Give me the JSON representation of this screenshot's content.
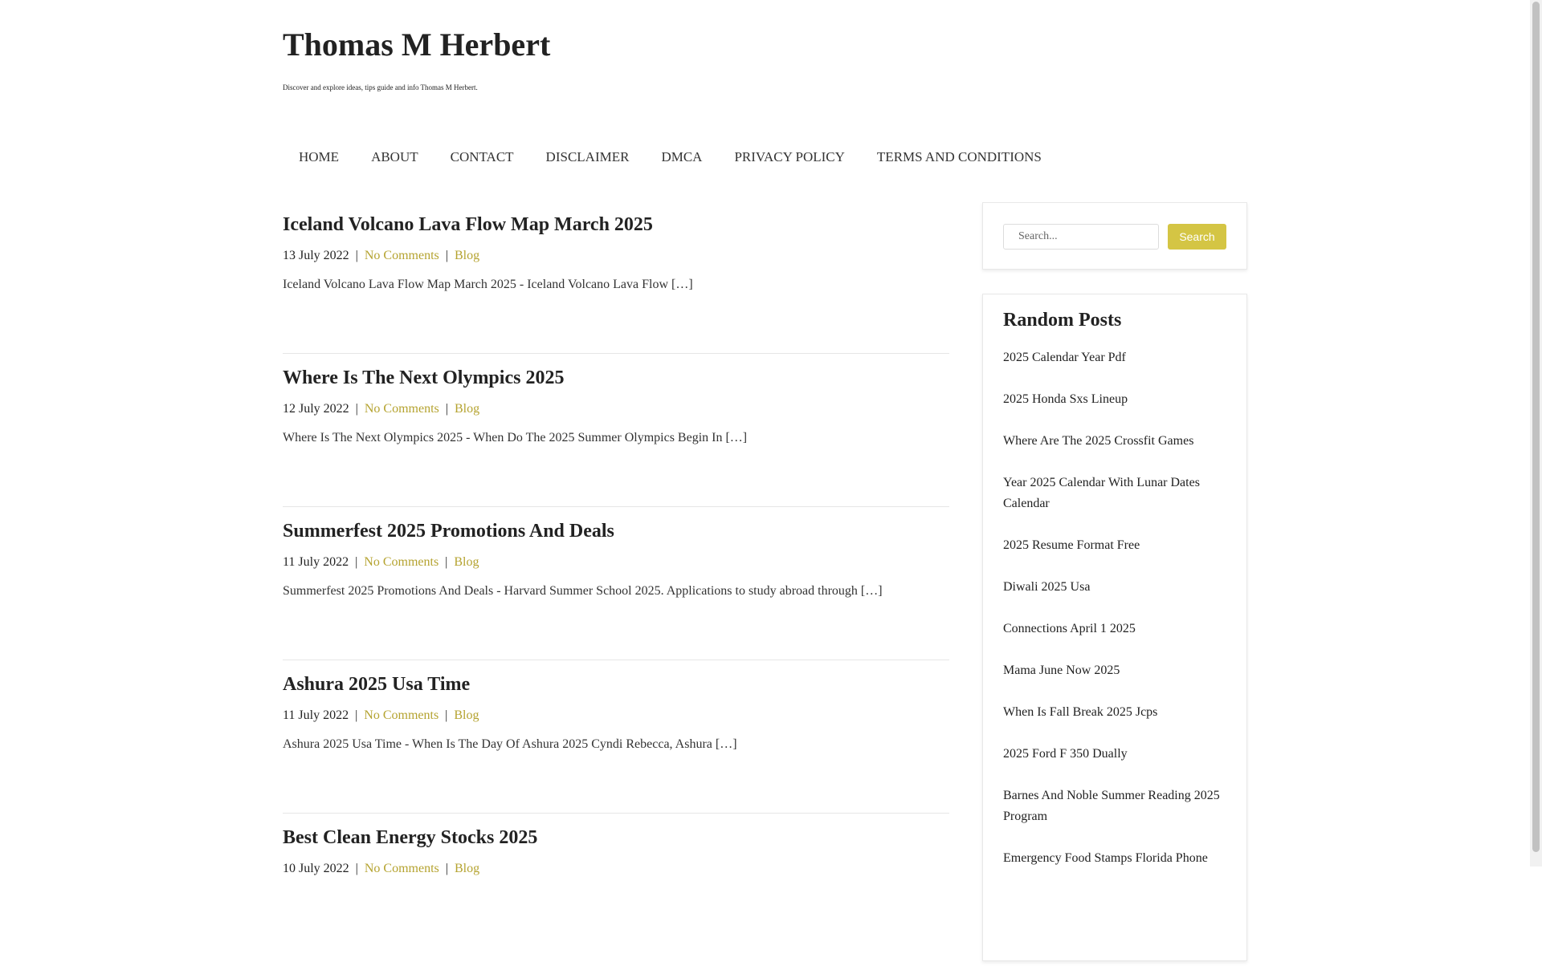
{
  "site": {
    "title": "Thomas M Herbert",
    "description": "Discover and explore ideas, tips guide and info Thomas M Herbert."
  },
  "nav": {
    "items": [
      "HOME",
      "ABOUT",
      "CONTACT",
      "DISCLAIMER",
      "DMCA",
      "PRIVACY POLICY",
      "TERMS AND CONDITIONS"
    ]
  },
  "posts": [
    {
      "title": "Iceland Volcano Lava Flow Map March 2025",
      "date": "13 July 2022",
      "comments": "No Comments",
      "category": "Blog",
      "excerpt": "Iceland Volcano Lava Flow Map March 2025 - Iceland Volcano Lava Flow […]"
    },
    {
      "title": "Where Is The Next Olympics 2025",
      "date": "12 July 2022",
      "comments": "No Comments",
      "category": "Blog",
      "excerpt": "Where Is The Next Olympics 2025 - When Do The 2025 Summer Olympics Begin In […]"
    },
    {
      "title": "Summerfest 2025 Promotions And Deals",
      "date": "11 July 2022",
      "comments": "No Comments",
      "category": "Blog",
      "excerpt": "Summerfest 2025 Promotions And Deals - Harvard Summer School 2025. Applications to study abroad through […]"
    },
    {
      "title": "Ashura 2025 Usa Time",
      "date": "11 July 2022",
      "comments": "No Comments",
      "category": "Blog",
      "excerpt": "Ashura 2025 Usa Time - When Is The Day Of Ashura 2025 Cyndi Rebecca, Ashura […]"
    },
    {
      "title": "Best Clean Energy Stocks 2025",
      "date": "10 July 2022",
      "comments": "No Comments",
      "category": "Blog",
      "excerpt": ""
    }
  ],
  "sidebar": {
    "search": {
      "placeholder": "Search...",
      "button_label": "Search"
    },
    "random_posts": {
      "title": "Random Posts",
      "items": [
        "2025 Calendar Year Pdf",
        "2025 Honda Sxs Lineup",
        "Where Are The 2025 Crossfit Games",
        "Year 2025 Calendar With Lunar Dates Calendar",
        "2025 Resume Format Free",
        "Diwali 2025 Usa",
        "Connections April 1 2025",
        "Mama June Now 2025",
        "When Is Fall Break 2025 Jcps",
        "2025 Ford F 350 Dually",
        "Barnes And Noble Summer Reading 2025 Program",
        "Emergency Food Stamps Florida Phone"
      ]
    }
  },
  "colors": {
    "link_accent": "#b5a330",
    "button": "#d4c544"
  }
}
